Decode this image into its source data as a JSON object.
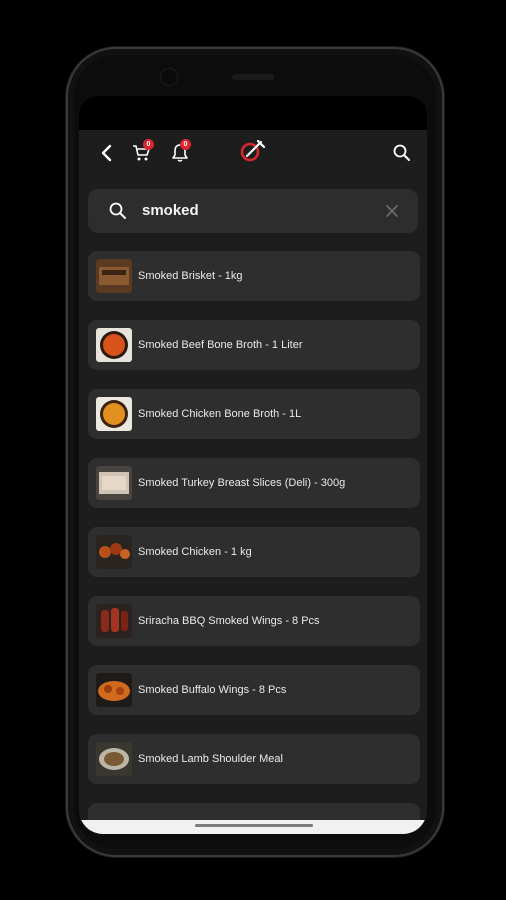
{
  "header": {
    "cart_count": "0",
    "notification_count": "0",
    "accent_color": "#d8262e"
  },
  "search": {
    "value": "smoked"
  },
  "results": [
    {
      "title": "Smoked Brisket - 1kg",
      "thumb": "brisket"
    },
    {
      "title": "Smoked Beef Bone Broth - 1 Liter",
      "thumb": "broth"
    },
    {
      "title": "Smoked Chicken Bone Broth - 1L",
      "thumb": "broth2"
    },
    {
      "title": "Smoked Turkey Breast Slices (Deli) - 300g",
      "thumb": "turkey"
    },
    {
      "title": "Smoked Chicken - 1 kg",
      "thumb": "chicken"
    },
    {
      "title": "Sriracha BBQ Smoked Wings - 8 Pcs",
      "thumb": "wings"
    },
    {
      "title": "Smoked Buffalo Wings - 8 Pcs",
      "thumb": "buffalo"
    },
    {
      "title": "Smoked Lamb Shoulder Meal",
      "thumb": "lamb"
    }
  ],
  "icons": {
    "back": "back-arrow-icon",
    "cart": "cart-icon",
    "bell": "notification-bell-icon",
    "logo": "app-logo-icon",
    "search": "search-icon",
    "clear": "close-icon"
  }
}
